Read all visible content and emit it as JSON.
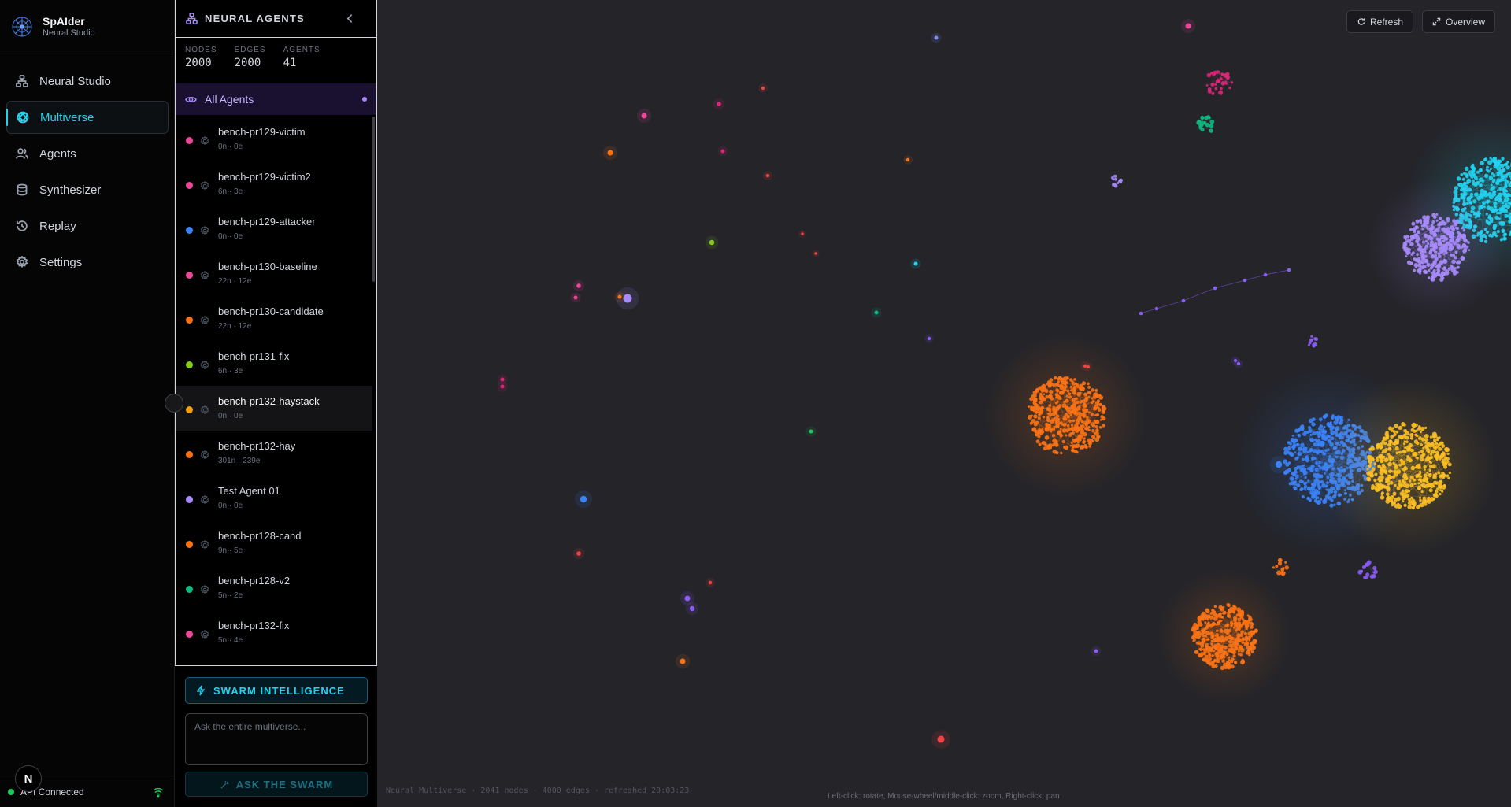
{
  "brand": {
    "title": "SpAIder",
    "subtitle": "Neural Studio"
  },
  "nav": [
    {
      "label": "Neural Studio",
      "icon": "network-icon",
      "active": false
    },
    {
      "label": "Multiverse",
      "icon": "orbit-icon",
      "active": true
    },
    {
      "label": "Agents",
      "icon": "users-icon",
      "active": false
    },
    {
      "label": "Synthesizer",
      "icon": "database-icon",
      "active": false
    },
    {
      "label": "Replay",
      "icon": "history-icon",
      "active": false
    },
    {
      "label": "Settings",
      "icon": "gear-icon",
      "active": false
    }
  ],
  "status": {
    "label": "API Connected",
    "badge": "N"
  },
  "panel": {
    "title": "NEURAL AGENTS",
    "stats": [
      {
        "label": "NODES",
        "value": "2000"
      },
      {
        "label": "EDGES",
        "value": "2000"
      },
      {
        "label": "AGENTS",
        "value": "41"
      }
    ],
    "all_agents_label": "All Agents",
    "agents": [
      {
        "name": "bench-pr129-victim",
        "meta": "0n · 0e",
        "color": "#ec4899"
      },
      {
        "name": "bench-pr129-victim2",
        "meta": "6n · 3e",
        "color": "#ec4899"
      },
      {
        "name": "bench-pr129-attacker",
        "meta": "0n · 0e",
        "color": "#3b82f6"
      },
      {
        "name": "bench-pr130-baseline",
        "meta": "22n · 12e",
        "color": "#ec4899"
      },
      {
        "name": "bench-pr130-candidate",
        "meta": "22n · 12e",
        "color": "#f97316"
      },
      {
        "name": "bench-pr131-fix",
        "meta": "6n · 3e",
        "color": "#84cc16"
      },
      {
        "name": "bench-pr132-haystack",
        "meta": "0n · 0e",
        "color": "#f59e0b"
      },
      {
        "name": "bench-pr132-hay",
        "meta": "301n · 239e",
        "color": "#f97316"
      },
      {
        "name": "Test Agent 01",
        "meta": "0n · 0e",
        "color": "#a78bfa"
      },
      {
        "name": "bench-pr128-cand",
        "meta": "9n · 5e",
        "color": "#f97316"
      },
      {
        "name": "bench-pr128-v2",
        "meta": "5n · 2e",
        "color": "#10b981"
      },
      {
        "name": "bench-pr132-fix",
        "meta": "5n · 4e",
        "color": "#ec4899"
      }
    ],
    "swarm_label": "SWARM INTELLIGENCE",
    "ask_placeholder": "Ask the entire multiverse...",
    "ask_value": "",
    "ask_button": "ASK THE SWARM"
  },
  "canvas": {
    "refresh_label": "Refresh",
    "overview_label": "Overview",
    "footer_info": "Neural Multiverse · 2041 nodes · 4000 edges · refreshed 20:03:23",
    "controls_hint": "Left-click: rotate, Mouse-wheel/middle-click: zoom, Right-click: pan"
  }
}
